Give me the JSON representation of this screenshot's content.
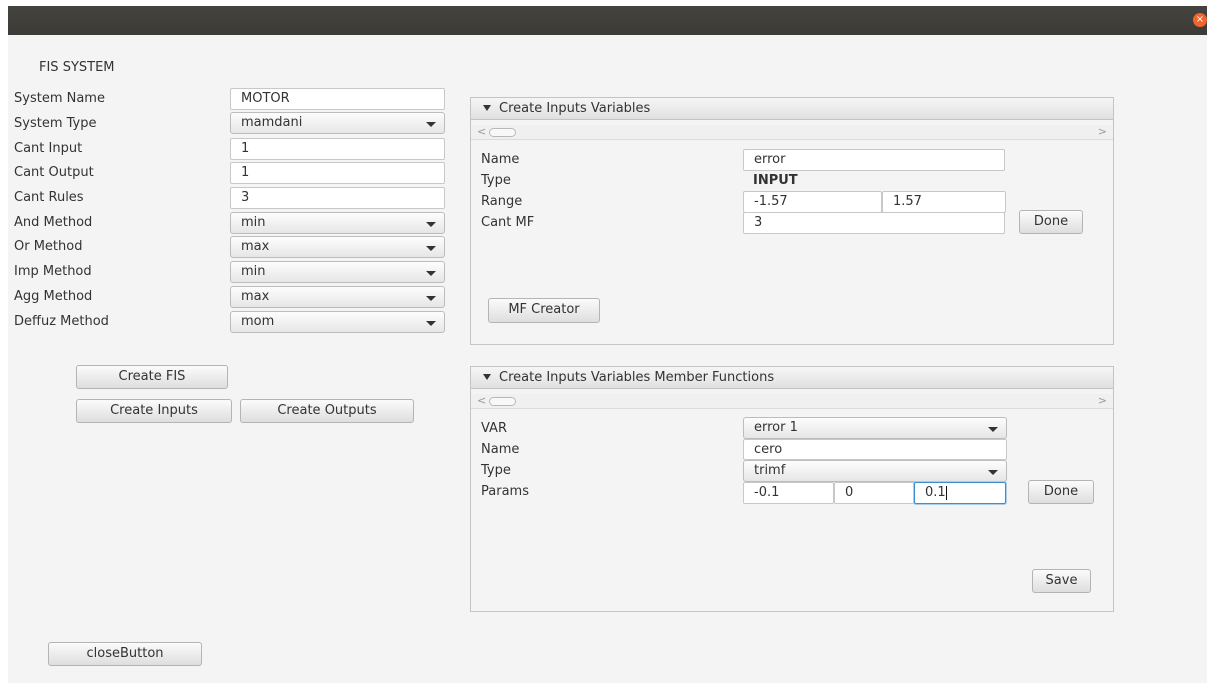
{
  "window": {
    "close_icon": "close-icon",
    "close_glyph": "×",
    "accent": "#f0652f"
  },
  "fis": {
    "title": "FIS SYSTEM",
    "rows": [
      {
        "label": "System Name",
        "kind": "text",
        "value": "MOTOR"
      },
      {
        "label": "System Type",
        "kind": "combo",
        "value": "mamdani"
      },
      {
        "label": "Cant Input",
        "kind": "text",
        "value": "1"
      },
      {
        "label": "Cant Output",
        "kind": "text",
        "value": "1"
      },
      {
        "label": "Cant Rules",
        "kind": "text",
        "value": "3"
      },
      {
        "label": "And Method",
        "kind": "combo",
        "value": "min"
      },
      {
        "label": "Or Method",
        "kind": "combo",
        "value": "max"
      },
      {
        "label": "Imp Method",
        "kind": "combo",
        "value": "min"
      },
      {
        "label": "Agg Method",
        "kind": "combo",
        "value": "max"
      },
      {
        "label": "Deffuz Method",
        "kind": "combo",
        "value": "mom"
      }
    ],
    "create_fis": "Create FIS",
    "create_inputs": "Create Inputs",
    "create_outputs": "Create Outputs",
    "close_button": "closeButton"
  },
  "inputs_pane": {
    "title": "Create Inputs Variables",
    "name_label": "Name",
    "name_value": "error",
    "type_label": "Type",
    "type_value": "INPUT",
    "range_label": "Range",
    "range_min": "-1.57",
    "range_max": "1.57",
    "cant_mf_label": "Cant MF",
    "cant_mf_value": "3",
    "done": "Done",
    "mf_creator": "MF Creator",
    "scroll_left": "<",
    "scroll_right": ">"
  },
  "mf_pane": {
    "title": "Create Inputs Variables Member Functions",
    "var_label": "VAR",
    "var_value": "error 1",
    "name_label": "Name",
    "name_value": "cero",
    "type_label": "Type",
    "type_value": "trimf",
    "params_label": "Params",
    "params": [
      "-0.1",
      "0",
      "0.1"
    ],
    "done": "Done",
    "save": "Save",
    "scroll_left": "<",
    "scroll_right": ">"
  }
}
